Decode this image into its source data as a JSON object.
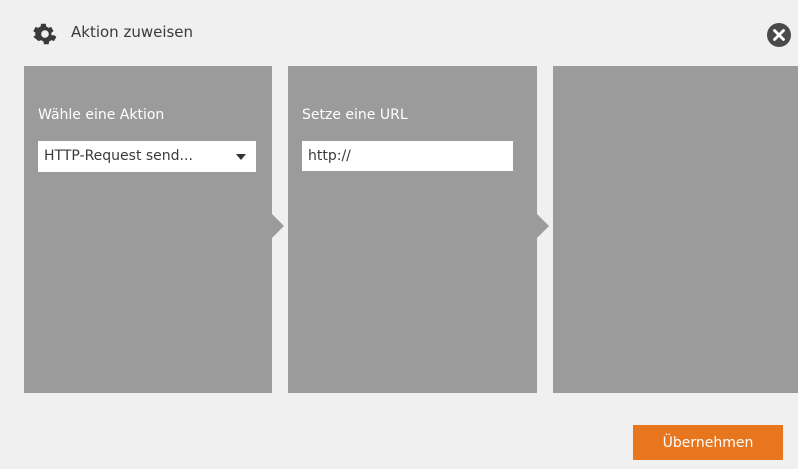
{
  "dialog": {
    "title": "Aktion zuweisen",
    "icons": {
      "title_icon": "gear-icon",
      "close_icon": "close-circle-icon"
    }
  },
  "panels": [
    {
      "label": "Wähle eine Aktion",
      "select_value": "HTTP-Request send..."
    },
    {
      "label": "Setze eine URL",
      "input_value": "http://"
    },
    {
      "label": ""
    }
  ],
  "footer": {
    "apply_label": "Übernehmen"
  },
  "colors": {
    "panel": "#9b9b9b",
    "accent": "#e8761f",
    "background": "#f0f0f0"
  }
}
